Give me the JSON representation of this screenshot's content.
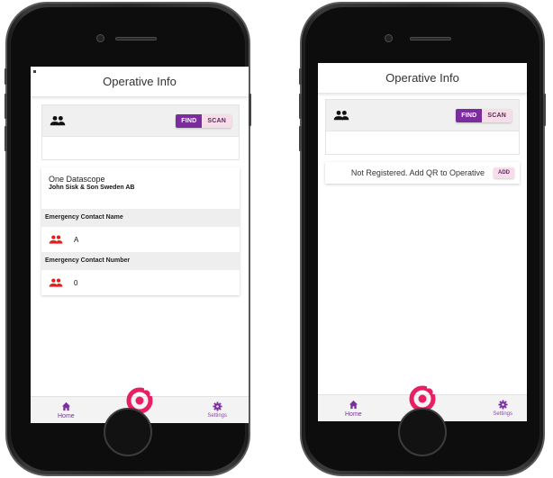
{
  "colors": {
    "accent": "#7b2d9e",
    "accent_light": "#f6dde8",
    "logo_pink": "#e91e63",
    "contact_red": "#e02020"
  },
  "left_screen": {
    "app_title": "Operative Info",
    "search": {
      "people_icon": "people-icon",
      "find_label": "FIND",
      "scan_label": "SCAN",
      "value": ""
    },
    "operative": {
      "company": "One Datascope",
      "employer": "John Sisk & Son Sweden AB",
      "emergency_name_header": "Emergency Contact Name",
      "emergency_name_value": "A",
      "emergency_number_header": "Emergency Contact Number",
      "emergency_number_value": "0"
    },
    "nav": {
      "home_label": "Home",
      "settings_label": "Settings"
    }
  },
  "right_screen": {
    "app_title": "Operative Info",
    "search": {
      "people_icon": "people-icon",
      "find_label": "FIND",
      "scan_label": "SCAN",
      "value": ""
    },
    "status_message": "Not Registered. Add QR to Operative",
    "add_label": "ADD",
    "nav": {
      "home_label": "Home",
      "settings_label": "Settings"
    }
  }
}
